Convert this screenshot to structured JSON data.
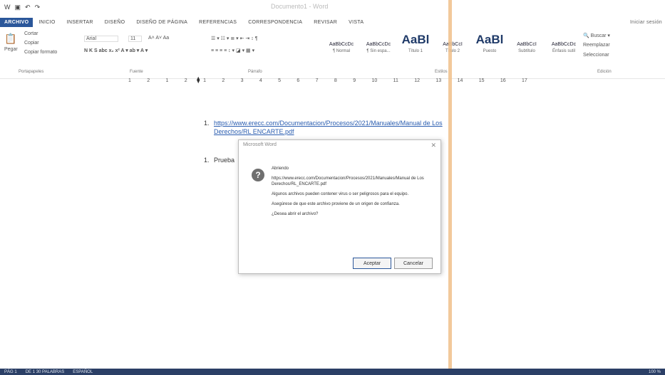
{
  "qat": {
    "app_icon": "W",
    "save_icon": "save-icon",
    "undo": "↶",
    "redo": "↷"
  },
  "window_title": "Documento1 - Word",
  "tabs": [
    "ARCHIVO",
    "INICIO",
    "INSERTAR",
    "DISEÑO",
    "DISEÑO DE PÁGINA",
    "REFERENCIAS",
    "CORRESPONDENCIA",
    "REVISAR",
    "VISTA"
  ],
  "signin": "Iniciar sesión",
  "ribbon": {
    "clipboard": {
      "paste": "Pegar",
      "cut": "Cortar",
      "copy": "Copiar",
      "format_painter": "Copiar formato",
      "label": "Portapapeles"
    },
    "font": {
      "name": "Arial",
      "size": "11",
      "label": "Fuente"
    },
    "paragraph": {
      "label": "Párrafo"
    },
    "styles": {
      "items": [
        {
          "preview": "AaBbCcDc",
          "name": "¶ Normal"
        },
        {
          "preview": "AaBbCcDc",
          "name": "¶ Sin espa..."
        },
        {
          "preview": "AaBl",
          "name": "Título 1"
        },
        {
          "preview": "AaBbCcI",
          "name": "Título 2"
        },
        {
          "preview": "AaBl",
          "name": "Puesto"
        },
        {
          "preview": "AaBbCcI",
          "name": "Subtítulo"
        },
        {
          "preview": "AaBbCcDc",
          "name": "Énfasis sutil"
        }
      ],
      "label": "Estilos"
    },
    "editing": {
      "find": "Buscar",
      "replace": "Reemplazar",
      "select": "Seleccionar",
      "label": "Edición"
    }
  },
  "ruler": [
    "1",
    "2",
    "1",
    "2",
    "1",
    "2",
    "3",
    "4",
    "5",
    "6",
    "7",
    "8",
    "9",
    "10",
    "11",
    "12",
    "13",
    "14",
    "15",
    "16",
    "17"
  ],
  "document": {
    "item1_number": "1.",
    "item1_link_line1": "https://www.erecc.com/Documentacion/Procesos/2021/Manuales/Manual de Los",
    "item1_link_line2": "Derechos/RL ENCARTE.pdf",
    "item2_number": "1.",
    "item2_text": "Prueba"
  },
  "dialog": {
    "title": "Microsoft Word",
    "close": "✕",
    "icon": "?",
    "heading": "Abriendo",
    "path": "https://www.erecc.com/Documentacion/Procesos/2021/Manuales/Manual de Los Derechos/RL_ENCARTE.pdf",
    "warning1": "Algunos archivos pueden contener virus o ser peligrosos para el equipo.",
    "warning2": "Asegúrese de que este archivo proviene de un origen de confianza.",
    "question": "¿Desea abrir el archivo?",
    "accept": "Aceptar",
    "cancel": "Cancelar"
  },
  "status": {
    "page": "PÁG 1",
    "words": "DE 1   30 PALABRAS",
    "language": "ESPAÑOL",
    "zoom": "100 %"
  }
}
